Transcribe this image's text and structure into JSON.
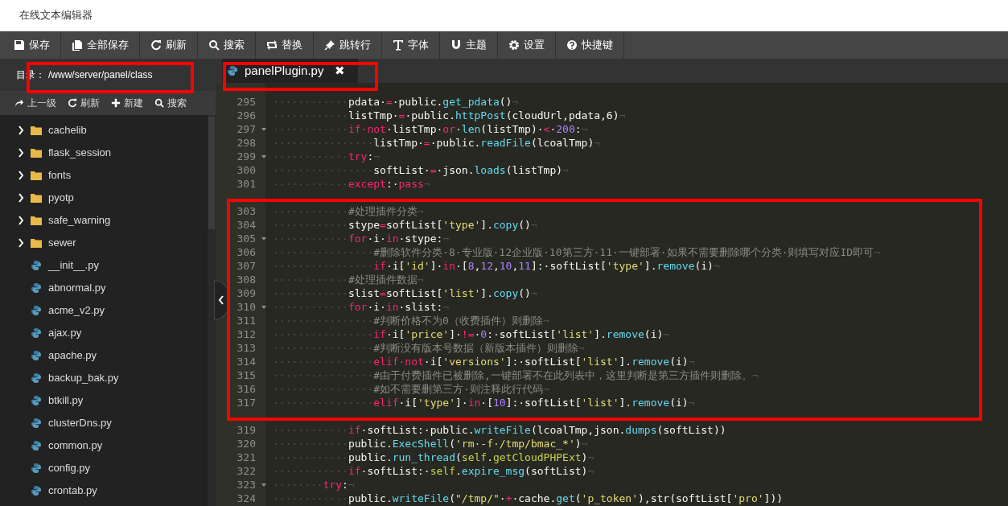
{
  "window": {
    "title": "在线文本编辑器"
  },
  "toolbar": [
    "保存",
    "全部保存",
    "刷新",
    "搜索",
    "替换",
    "跳转行",
    "字体",
    "主题",
    "设置",
    "快捷键"
  ],
  "sidebar": {
    "directory_label": "目录：",
    "path": "/www/server/panel/class",
    "actions": [
      "上一级",
      "刷新",
      "新建",
      "搜索"
    ],
    "items": [
      {
        "kind": "folder",
        "name": "cachelib"
      },
      {
        "kind": "folder",
        "name": "flask_session"
      },
      {
        "kind": "folder",
        "name": "fonts"
      },
      {
        "kind": "folder",
        "name": "pyotp"
      },
      {
        "kind": "folder",
        "name": "safe_warning"
      },
      {
        "kind": "folder",
        "name": "sewer"
      },
      {
        "kind": "file",
        "name": "__init__.py"
      },
      {
        "kind": "file",
        "name": "abnormal.py"
      },
      {
        "kind": "file",
        "name": "acme_v2.py"
      },
      {
        "kind": "file",
        "name": "ajax.py"
      },
      {
        "kind": "file",
        "name": "apache.py"
      },
      {
        "kind": "file",
        "name": "backup_bak.py"
      },
      {
        "kind": "file",
        "name": "btkill.py"
      },
      {
        "kind": "file",
        "name": "clusterDns.py"
      },
      {
        "kind": "file",
        "name": "common.py"
      },
      {
        "kind": "file",
        "name": "config.py"
      },
      {
        "kind": "file",
        "name": "crontab.py"
      }
    ]
  },
  "tabs": [
    {
      "label": "panelPlugin.py",
      "close": "✖",
      "selected": true
    }
  ],
  "editor": {
    "lines": [
      {
        "kind": "code",
        "number": "295",
        "foldable": false,
        "tokens": [
          {
            "kind": "whitespace",
            "text": "············"
          },
          {
            "kind": "plain",
            "text": "pdata·"
          },
          {
            "kind": "keyword",
            "text": "="
          },
          {
            "kind": "plain",
            "text": "·public."
          },
          {
            "kind": "function",
            "text": "get_pdata"
          },
          {
            "kind": "plain",
            "text": "()"
          },
          {
            "kind": "whitespace",
            "text": "¬"
          }
        ]
      },
      {
        "kind": "code",
        "number": "296",
        "foldable": false,
        "tokens": [
          {
            "kind": "whitespace",
            "text": "············"
          },
          {
            "kind": "plain",
            "text": "listTmp·"
          },
          {
            "kind": "keyword",
            "text": "="
          },
          {
            "kind": "plain",
            "text": "·public."
          },
          {
            "kind": "function",
            "text": "httpPost"
          },
          {
            "kind": "plain",
            "text": "(cloudUrl,pdata,6)"
          },
          {
            "kind": "whitespace",
            "text": "¬"
          }
        ]
      },
      {
        "kind": "code",
        "number": "297",
        "foldable": true,
        "tokens": [
          {
            "kind": "whitespace",
            "text": "············"
          },
          {
            "kind": "keyword",
            "text": "if·not"
          },
          {
            "kind": "plain",
            "text": "·listTmp·"
          },
          {
            "kind": "keyword",
            "text": "or"
          },
          {
            "kind": "plain",
            "text": "·"
          },
          {
            "kind": "function",
            "text": "len"
          },
          {
            "kind": "plain",
            "text": "(listTmp)·"
          },
          {
            "kind": "keyword",
            "text": "<"
          },
          {
            "kind": "plain",
            "text": "·"
          },
          {
            "kind": "number",
            "text": "200"
          },
          {
            "kind": "plain",
            "text": ":"
          },
          {
            "kind": "whitespace",
            "text": "¬"
          }
        ]
      },
      {
        "kind": "code",
        "number": "298",
        "foldable": false,
        "tokens": [
          {
            "kind": "whitespace",
            "text": "················"
          },
          {
            "kind": "plain",
            "text": "listTmp·"
          },
          {
            "kind": "keyword",
            "text": "="
          },
          {
            "kind": "plain",
            "text": "·public."
          },
          {
            "kind": "function",
            "text": "readFile"
          },
          {
            "kind": "plain",
            "text": "(lcoalTmp)"
          },
          {
            "kind": "whitespace",
            "text": "¬"
          }
        ]
      },
      {
        "kind": "code",
        "number": "299",
        "foldable": true,
        "tokens": [
          {
            "kind": "whitespace",
            "text": "············"
          },
          {
            "kind": "keyword",
            "text": "try"
          },
          {
            "kind": "plain",
            "text": ":"
          },
          {
            "kind": "whitespace",
            "text": "¬"
          }
        ]
      },
      {
        "kind": "code",
        "number": "300",
        "foldable": false,
        "tokens": [
          {
            "kind": "whitespace",
            "text": "················"
          },
          {
            "kind": "plain",
            "text": "softList·"
          },
          {
            "kind": "keyword",
            "text": "="
          },
          {
            "kind": "plain",
            "text": "·json."
          },
          {
            "kind": "function",
            "text": "loads"
          },
          {
            "kind": "plain",
            "text": "(listTmp)"
          },
          {
            "kind": "whitespace",
            "text": "¬"
          }
        ]
      },
      {
        "kind": "code",
        "number": "301",
        "foldable": false,
        "tokens": [
          {
            "kind": "whitespace",
            "text": "············"
          },
          {
            "kind": "keyword",
            "text": "except"
          },
          {
            "kind": "plain",
            "text": ":·"
          },
          {
            "kind": "keyword",
            "text": "pass"
          },
          {
            "kind": "whitespace",
            "text": "¬"
          }
        ]
      },
      {
        "kind": "blank"
      },
      {
        "kind": "code",
        "number": "303",
        "foldable": false,
        "tokens": [
          {
            "kind": "whitespace",
            "text": "············"
          },
          {
            "kind": "comment",
            "text": "#处理插件分类"
          },
          {
            "kind": "whitespace",
            "text": "¬"
          }
        ]
      },
      {
        "kind": "code",
        "number": "304",
        "foldable": false,
        "tokens": [
          {
            "kind": "whitespace",
            "text": "············"
          },
          {
            "kind": "plain",
            "text": "stype"
          },
          {
            "kind": "keyword",
            "text": "="
          },
          {
            "kind": "plain",
            "text": "softList["
          },
          {
            "kind": "string",
            "text": "'type'"
          },
          {
            "kind": "plain",
            "text": "]."
          },
          {
            "kind": "function",
            "text": "copy"
          },
          {
            "kind": "plain",
            "text": "()"
          },
          {
            "kind": "whitespace",
            "text": "¬"
          }
        ]
      },
      {
        "kind": "code",
        "number": "305",
        "foldable": true,
        "tokens": [
          {
            "kind": "whitespace",
            "text": "············"
          },
          {
            "kind": "keyword",
            "text": "for"
          },
          {
            "kind": "plain",
            "text": "·i·"
          },
          {
            "kind": "keyword",
            "text": "in"
          },
          {
            "kind": "plain",
            "text": "·stype:"
          },
          {
            "kind": "whitespace",
            "text": "¬"
          }
        ]
      },
      {
        "kind": "code",
        "number": "306",
        "foldable": false,
        "tokens": [
          {
            "kind": "whitespace",
            "text": "················"
          },
          {
            "kind": "comment",
            "text": "#删除软件分类·8·专业版·12企业版·10第三方·11·一键部署·如果不需要删除哪个分类·则填写对应ID即可"
          },
          {
            "kind": "whitespace",
            "text": "¬"
          }
        ]
      },
      {
        "kind": "code",
        "number": "307",
        "foldable": false,
        "tokens": [
          {
            "kind": "whitespace",
            "text": "················"
          },
          {
            "kind": "keyword",
            "text": "if"
          },
          {
            "kind": "plain",
            "text": "·i["
          },
          {
            "kind": "string",
            "text": "'id'"
          },
          {
            "kind": "plain",
            "text": "]·"
          },
          {
            "kind": "keyword",
            "text": "in"
          },
          {
            "kind": "plain",
            "text": "·["
          },
          {
            "kind": "number",
            "text": "8"
          },
          {
            "kind": "plain",
            "text": ","
          },
          {
            "kind": "number",
            "text": "12"
          },
          {
            "kind": "plain",
            "text": ","
          },
          {
            "kind": "number",
            "text": "10"
          },
          {
            "kind": "plain",
            "text": ","
          },
          {
            "kind": "number",
            "text": "11"
          },
          {
            "kind": "plain",
            "text": "]:·softList["
          },
          {
            "kind": "string",
            "text": "'type'"
          },
          {
            "kind": "plain",
            "text": "]."
          },
          {
            "kind": "function",
            "text": "remove"
          },
          {
            "kind": "plain",
            "text": "(i)"
          },
          {
            "kind": "whitespace",
            "text": "¬"
          }
        ]
      },
      {
        "kind": "code",
        "number": "308",
        "foldable": false,
        "tokens": [
          {
            "kind": "whitespace",
            "text": "············"
          },
          {
            "kind": "comment",
            "text": "#处理插件数据"
          },
          {
            "kind": "whitespace",
            "text": "¬"
          }
        ]
      },
      {
        "kind": "code",
        "number": "309",
        "foldable": false,
        "tokens": [
          {
            "kind": "whitespace",
            "text": "············"
          },
          {
            "kind": "plain",
            "text": "slist"
          },
          {
            "kind": "keyword",
            "text": "="
          },
          {
            "kind": "plain",
            "text": "softList["
          },
          {
            "kind": "string",
            "text": "'list'"
          },
          {
            "kind": "plain",
            "text": "]."
          },
          {
            "kind": "function",
            "text": "copy"
          },
          {
            "kind": "plain",
            "text": "()"
          },
          {
            "kind": "whitespace",
            "text": "¬"
          }
        ]
      },
      {
        "kind": "code",
        "number": "310",
        "foldable": true,
        "tokens": [
          {
            "kind": "whitespace",
            "text": "············"
          },
          {
            "kind": "keyword",
            "text": "for"
          },
          {
            "kind": "plain",
            "text": "·i·"
          },
          {
            "kind": "keyword",
            "text": "in"
          },
          {
            "kind": "plain",
            "text": "·slist:"
          },
          {
            "kind": "whitespace",
            "text": "¬"
          }
        ]
      },
      {
        "kind": "code",
        "number": "311",
        "foldable": false,
        "tokens": [
          {
            "kind": "whitespace",
            "text": "················"
          },
          {
            "kind": "comment",
            "text": "#判断价格不为0（收费插件）则删除"
          },
          {
            "kind": "whitespace",
            "text": "¬"
          }
        ]
      },
      {
        "kind": "code",
        "number": "312",
        "foldable": false,
        "tokens": [
          {
            "kind": "whitespace",
            "text": "················"
          },
          {
            "kind": "keyword",
            "text": "if"
          },
          {
            "kind": "plain",
            "text": "·i["
          },
          {
            "kind": "string",
            "text": "'price'"
          },
          {
            "kind": "plain",
            "text": "]·"
          },
          {
            "kind": "keyword",
            "text": "!="
          },
          {
            "kind": "plain",
            "text": "·"
          },
          {
            "kind": "number",
            "text": "0"
          },
          {
            "kind": "plain",
            "text": ":·softList["
          },
          {
            "kind": "string",
            "text": "'list'"
          },
          {
            "kind": "plain",
            "text": "]."
          },
          {
            "kind": "function",
            "text": "remove"
          },
          {
            "kind": "plain",
            "text": "(i)"
          },
          {
            "kind": "whitespace",
            "text": "¬"
          }
        ]
      },
      {
        "kind": "code",
        "number": "313",
        "foldable": false,
        "tokens": [
          {
            "kind": "whitespace",
            "text": "················"
          },
          {
            "kind": "comment",
            "text": "#判断没有版本号数据（新版本插件）则删除"
          },
          {
            "kind": "whitespace",
            "text": "¬"
          }
        ]
      },
      {
        "kind": "code",
        "number": "314",
        "foldable": false,
        "tokens": [
          {
            "kind": "whitespace",
            "text": "················"
          },
          {
            "kind": "keyword",
            "text": "elif·not"
          },
          {
            "kind": "plain",
            "text": "·i["
          },
          {
            "kind": "string",
            "text": "'versions'"
          },
          {
            "kind": "plain",
            "text": "]:·softList["
          },
          {
            "kind": "string",
            "text": "'list'"
          },
          {
            "kind": "plain",
            "text": "]."
          },
          {
            "kind": "function",
            "text": "remove"
          },
          {
            "kind": "plain",
            "text": "(i)"
          },
          {
            "kind": "whitespace",
            "text": "¬"
          }
        ]
      },
      {
        "kind": "code",
        "number": "315",
        "foldable": false,
        "tokens": [
          {
            "kind": "whitespace",
            "text": "················"
          },
          {
            "kind": "comment",
            "text": "#由于付费插件已被删除,一键部署不在此列表中，这里判断是第三方插件则删除。"
          },
          {
            "kind": "whitespace",
            "text": "¬"
          }
        ]
      },
      {
        "kind": "code",
        "number": "316",
        "foldable": false,
        "tokens": [
          {
            "kind": "whitespace",
            "text": "················"
          },
          {
            "kind": "comment",
            "text": "#如不需要删第三方·则注释此行代码"
          },
          {
            "kind": "whitespace",
            "text": "¬"
          }
        ]
      },
      {
        "kind": "code",
        "number": "317",
        "foldable": false,
        "tokens": [
          {
            "kind": "whitespace",
            "text": "················"
          },
          {
            "kind": "keyword",
            "text": "elif"
          },
          {
            "kind": "plain",
            "text": "·i["
          },
          {
            "kind": "string",
            "text": "'type'"
          },
          {
            "kind": "plain",
            "text": "]·"
          },
          {
            "kind": "keyword",
            "text": "in"
          },
          {
            "kind": "plain",
            "text": "·["
          },
          {
            "kind": "number",
            "text": "10"
          },
          {
            "kind": "plain",
            "text": "]:·softList["
          },
          {
            "kind": "string",
            "text": "'list'"
          },
          {
            "kind": "plain",
            "text": "]."
          },
          {
            "kind": "function",
            "text": "remove"
          },
          {
            "kind": "plain",
            "text": "(i)"
          },
          {
            "kind": "whitespace",
            "text": "¬"
          }
        ]
      },
      {
        "kind": "blank"
      },
      {
        "kind": "code",
        "number": "319",
        "foldable": false,
        "tokens": [
          {
            "kind": "whitespace",
            "text": "············"
          },
          {
            "kind": "keyword",
            "text": "if"
          },
          {
            "kind": "plain",
            "text": "·softList:·public."
          },
          {
            "kind": "function",
            "text": "writeFile"
          },
          {
            "kind": "plain",
            "text": "(lcoalTmp,json."
          },
          {
            "kind": "function",
            "text": "dumps"
          },
          {
            "kind": "plain",
            "text": "(softList))"
          }
        ]
      },
      {
        "kind": "code",
        "number": "320",
        "foldable": false,
        "tokens": [
          {
            "kind": "whitespace",
            "text": "············"
          },
          {
            "kind": "plain",
            "text": "public."
          },
          {
            "kind": "function",
            "text": "ExecShell"
          },
          {
            "kind": "plain",
            "text": "("
          },
          {
            "kind": "string",
            "text": "'rm·-f·/tmp/bmac_*'"
          },
          {
            "kind": "plain",
            "text": ")"
          },
          {
            "kind": "whitespace",
            "text": "¬"
          }
        ]
      },
      {
        "kind": "code",
        "number": "321",
        "foldable": false,
        "tokens": [
          {
            "kind": "whitespace",
            "text": "············"
          },
          {
            "kind": "plain",
            "text": "public."
          },
          {
            "kind": "function",
            "text": "run_thread"
          },
          {
            "kind": "plain",
            "text": "("
          },
          {
            "kind": "self",
            "text": "self"
          },
          {
            "kind": "plain",
            "text": "."
          },
          {
            "kind": "self",
            "text": "getCloudPHPExt"
          },
          {
            "kind": "plain",
            "text": ")"
          },
          {
            "kind": "whitespace",
            "text": "¬"
          }
        ]
      },
      {
        "kind": "code",
        "number": "322",
        "foldable": false,
        "tokens": [
          {
            "kind": "whitespace",
            "text": "············"
          },
          {
            "kind": "keyword",
            "text": "if"
          },
          {
            "kind": "plain",
            "text": "·softList:·"
          },
          {
            "kind": "self",
            "text": "self"
          },
          {
            "kind": "plain",
            "text": "."
          },
          {
            "kind": "function",
            "text": "expire_msg"
          },
          {
            "kind": "plain",
            "text": "(softList)"
          },
          {
            "kind": "whitespace",
            "text": "¬"
          }
        ]
      },
      {
        "kind": "code",
        "number": "323",
        "foldable": true,
        "tokens": [
          {
            "kind": "whitespace",
            "text": "········"
          },
          {
            "kind": "keyword",
            "text": "try"
          },
          {
            "kind": "plain",
            "text": ":"
          },
          {
            "kind": "whitespace",
            "text": "¬"
          }
        ]
      },
      {
        "kind": "code",
        "number": "324",
        "foldable": false,
        "tokens": [
          {
            "kind": "whitespace",
            "text": "············"
          },
          {
            "kind": "plain",
            "text": "public."
          },
          {
            "kind": "function",
            "text": "writeFile"
          },
          {
            "kind": "plain",
            "text": "("
          },
          {
            "kind": "string",
            "text": "\"/tmp/\""
          },
          {
            "kind": "plain",
            "text": "·"
          },
          {
            "kind": "keyword",
            "text": "+"
          },
          {
            "kind": "plain",
            "text": "·cache."
          },
          {
            "kind": "function",
            "text": "get"
          },
          {
            "kind": "plain",
            "text": "("
          },
          {
            "kind": "string",
            "text": "'p_token'"
          },
          {
            "kind": "plain",
            "text": "),str(softList["
          },
          {
            "kind": "string",
            "text": "'pro'"
          },
          {
            "kind": "plain",
            "text": "]))"
          }
        ]
      }
    ]
  }
}
